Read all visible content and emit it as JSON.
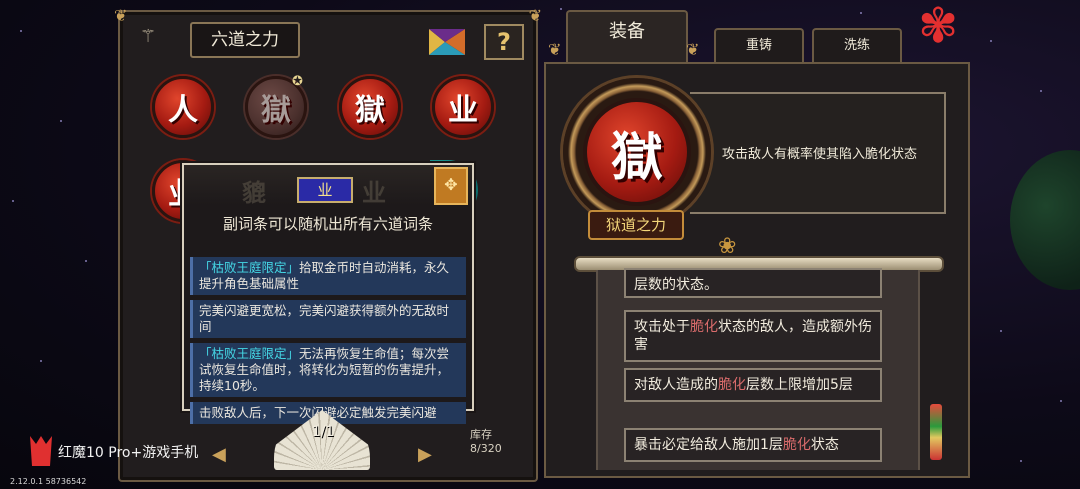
{
  "left_panel": {
    "title": "六道之力",
    "help_label": "?",
    "orbs_row1": [
      "人",
      "獄",
      "獄",
      "业"
    ],
    "orbs_row2": [
      "业"
    ],
    "ghost_chars": [
      "貔",
      "业"
    ]
  },
  "tooltip": {
    "badge": "业",
    "title": "副词条可以随机出所有六道词条",
    "items": [
      {
        "highlight": "「枯败王庭限定」",
        "text": "拾取金币时自动消耗，永久提升角色基础属性"
      },
      {
        "highlight": "",
        "text": "完美闪避更宽松，完美闪避获得额外的无敌时间"
      },
      {
        "highlight": "「枯败王庭限定」",
        "text": "无法再恢复生命值；每次尝试恢复生命值时，将转化为短暂的伤害提升，持续10秒。"
      },
      {
        "highlight": "",
        "text": "击败敌人后，下一次闪避必定触发完美闪避"
      }
    ]
  },
  "pager": {
    "page": "1/1",
    "storage_label": "库存",
    "storage_count": "8/320"
  },
  "tabs": {
    "equip": "装备",
    "reforge": "重铸",
    "refine": "洗练"
  },
  "equipped": {
    "char": "獄",
    "name": "狱道之力",
    "description": "攻击敌人有概率使其陷入脆化状态"
  },
  "affixes": [
    {
      "parts": [
        "层数的状态。"
      ]
    },
    {
      "parts": [
        "攻击处于",
        "脆化",
        "状态的敌人，造成额外伤害"
      ]
    },
    {
      "parts": [
        "对敌人造成的",
        "脆化",
        "层数上限增加5层"
      ]
    },
    {
      "parts": [
        "暴击必定给敌人施加1层",
        "脆化",
        "状态"
      ]
    }
  ],
  "watermark": {
    "brand": "红魔10 Pro+游戏手机",
    "version": "2.12.0.1 58736542"
  },
  "colors": {
    "panel_bg": "#211d1e",
    "panel_border": "#6b5a43",
    "orb_red": "#a51b12",
    "highlight_cyan": "#45d8e6",
    "highlight_red": "#d96b6b",
    "tooltip_item_bg": "#23385a"
  }
}
